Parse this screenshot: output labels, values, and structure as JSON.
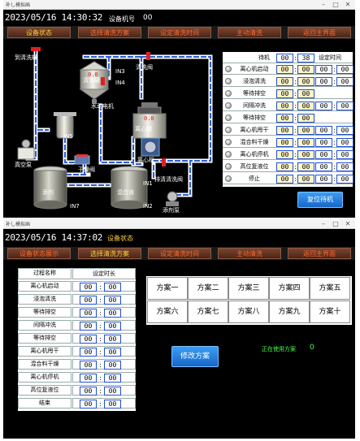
{
  "top_window": {
    "title": "补し模拟画",
    "datetime": "2023/05/16 14:30:32",
    "machine_label": "设备机号",
    "machine_no": "00",
    "nav": [
      "设备状态",
      "选择清洗方案",
      "设定清洗时间",
      "主动清洗",
      "返回主界面"
    ],
    "diagram": {
      "labels": {
        "wash_tank": "清洗罐",
        "main_pump": "水动电机",
        "clear_valve": "清洗阀",
        "centrifuge": "离心罐",
        "centrifuge_machine": "离心机",
        "vacuum_pump": "真空泵",
        "dry_valve": "干燥阀",
        "drain_valve": "排清清洗阀",
        "dryer": "干燥机",
        "ingredient": "添剂",
        "mixer": "混合液",
        "discharge": "排出口",
        "inlet": "回流",
        "dose_pump": "添剂泵",
        "in3": "IN3",
        "in4": "IN4",
        "in5": "IN5",
        "in1": "IN1",
        "in2": "IN2",
        "in7": "IN7",
        "clean_top": "到清洗罐"
      }
    },
    "panel": {
      "header_label": "待机",
      "header_time": [
        "00",
        "38"
      ],
      "header_right": "设定时间",
      "rows": [
        {
          "name": "离心机启动",
          "a": "00",
          "b": "00",
          "c": "00",
          "d": "00"
        },
        {
          "name": "浸泡清洗",
          "a": "00",
          "b": "00",
          "c": "00",
          "d": "00"
        },
        {
          "name": "等待排空",
          "a": "00",
          "b": "00",
          "c": "",
          "d": ""
        },
        {
          "name": "间隔冲洗",
          "a": "00",
          "b": "00",
          "c": "00",
          "d": "00"
        },
        {
          "name": "等待排空",
          "a": "00",
          "b": "00",
          "c": "",
          "d": ""
        },
        {
          "name": "离心机甩干",
          "a": "00",
          "b": "00",
          "c": "00",
          "d": "00"
        },
        {
          "name": "混合料干燥",
          "a": "00",
          "b": "00",
          "c": "00",
          "d": "00"
        },
        {
          "name": "离心机停机",
          "a": "00",
          "b": "00",
          "c": "00",
          "d": "00"
        },
        {
          "name": "高位复液位",
          "a": "00",
          "b": "00",
          "c": "00",
          "d": "00"
        },
        {
          "name": "停止",
          "a": "00",
          "b": "00",
          "c": "00",
          "d": "00"
        }
      ],
      "reset_button": "复位待机"
    }
  },
  "bottom_window": {
    "title": "补し模拟画",
    "datetime": "2023/05/16 14:37:02",
    "tag": "设备状态",
    "nav": [
      "设备状态展示",
      "选择清洗方案",
      "设定清洗时间",
      "主动清洗",
      "返回主界面"
    ],
    "table_header": [
      "过程名称",
      "设定时长"
    ],
    "table_rows": [
      {
        "name": "离心机启动",
        "a": "00",
        "b": "00"
      },
      {
        "name": "浸泡清洗",
        "a": "00",
        "b": "00"
      },
      {
        "name": "等待排空",
        "a": "00",
        "b": "00"
      },
      {
        "name": "间隔冲洗",
        "a": "00",
        "b": "00"
      },
      {
        "name": "等待排空",
        "a": "00",
        "b": "00"
      },
      {
        "name": "离心机甩干",
        "a": "00",
        "b": "00"
      },
      {
        "name": "混合料干燥",
        "a": "00",
        "b": "00"
      },
      {
        "name": "离心机停机",
        "a": "00",
        "b": "00"
      },
      {
        "name": "高位复液位",
        "a": "00",
        "b": "00"
      },
      {
        "name": "结束",
        "a": "00",
        "b": "00"
      }
    ],
    "plans": [
      "方案一",
      "方案二",
      "方案三",
      "方案四",
      "方案五",
      "方案六",
      "方案七",
      "方案八",
      "方案九",
      "方案十"
    ],
    "modify_button": "修改方案",
    "current_plan_label": "正在使用方案",
    "current_plan_value": "0"
  }
}
